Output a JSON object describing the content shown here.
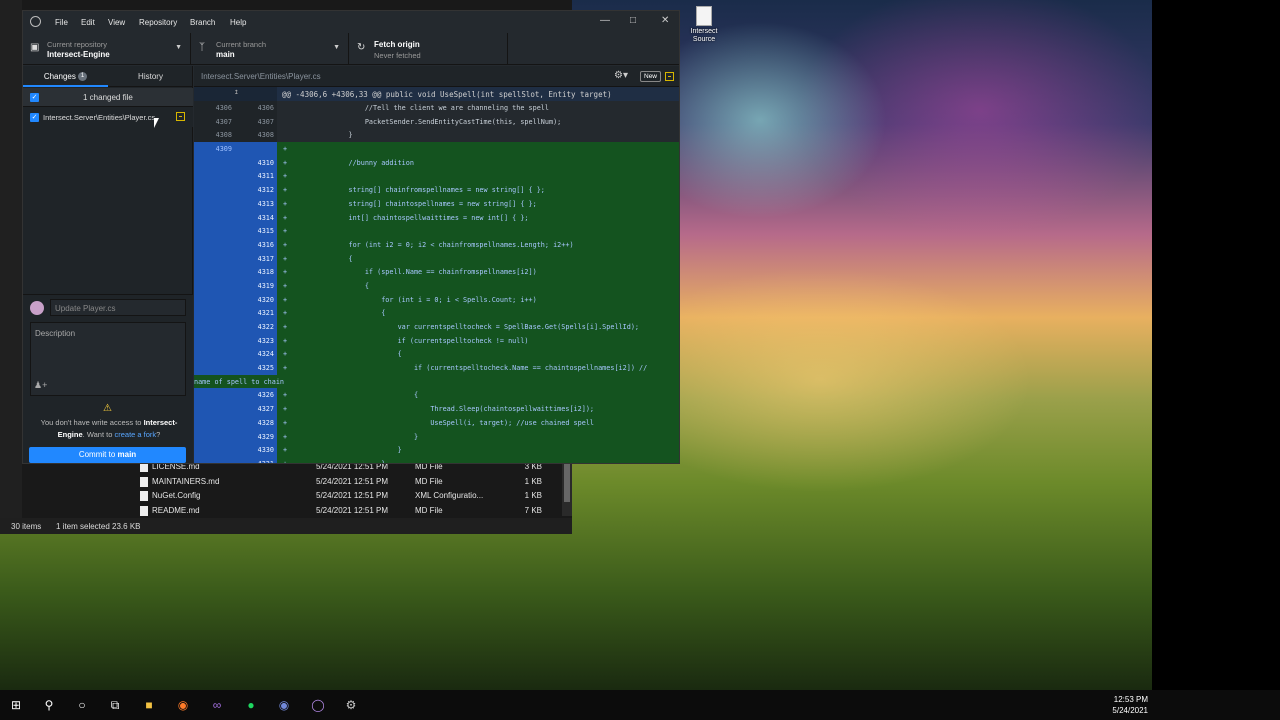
{
  "desktop": {
    "icon_label": "Intersect Source"
  },
  "explorer": {
    "files": [
      {
        "name": "LICENSE.md",
        "date": "5/24/2021 12:51 PM",
        "type": "MD File",
        "size": "3 KB"
      },
      {
        "name": "MAINTAINERS.md",
        "date": "5/24/2021 12:51 PM",
        "type": "MD File",
        "size": "1 KB"
      },
      {
        "name": "NuGet.Config",
        "date": "5/24/2021 12:51 PM",
        "type": "XML Configuratio...",
        "size": "1 KB"
      },
      {
        "name": "README.md",
        "date": "5/24/2021 12:51 PM",
        "type": "MD File",
        "size": "7 KB"
      }
    ],
    "status_items": "30 items",
    "status_selected": "1 item selected  23.6 KB"
  },
  "github": {
    "menu": [
      "File",
      "Edit",
      "View",
      "Repository",
      "Branch",
      "Help"
    ],
    "repo_label": "Current repository",
    "repo_name": "Intersect-Engine",
    "branch_label": "Current branch",
    "branch_name": "main",
    "fetch_label": "Fetch origin",
    "fetch_sub": "Never fetched",
    "tab_changes": "Changes",
    "changes_count": "1",
    "tab_history": "History",
    "changed_files": "1 changed file",
    "file_path": "Intersect.Server\\Entities\\Player.cs",
    "summary_placeholder": "Update Player.cs",
    "description_placeholder": "Description",
    "warn_text_1": "You don't have write access to ",
    "warn_repo": "Intersect-Engine",
    "warn_text_2": ". Want to ",
    "warn_link": "create a fork",
    "warn_text_3": "?",
    "commit_label": "Commit to ",
    "commit_branch": "main",
    "diff_path": "Intersect.Server\\Entities\\Player.cs",
    "new_label": "New",
    "hunk_header": "@@ -4306,6 +4306,33 @@ public void UseSpell(int spellSlot, Entity target)",
    "lines": [
      {
        "kind": "ctx",
        "old": "4306",
        "new": "4306",
        "code": "                    //Tell the client we are channeling the spell"
      },
      {
        "kind": "ctx",
        "old": "4307",
        "new": "4307",
        "code": "                    PacketSender.SendEntityCastTime(this, spellNum);"
      },
      {
        "kind": "ctx",
        "old": "4308",
        "new": "4308",
        "code": "                }"
      },
      {
        "kind": "add",
        "old": "4309",
        "new": "",
        "code": "+"
      },
      {
        "kind": "add",
        "old": "",
        "new": "4310",
        "code": "+               //bunny addition"
      },
      {
        "kind": "add",
        "old": "",
        "new": "4311",
        "code": "+"
      },
      {
        "kind": "add",
        "old": "",
        "new": "4312",
        "code": "+               string[] chainfromspellnames = new string[] { };"
      },
      {
        "kind": "add",
        "old": "",
        "new": "4313",
        "code": "+               string[] chaintospellnames = new string[] { };"
      },
      {
        "kind": "add",
        "old": "",
        "new": "4314",
        "code": "+               int[] chaintospellwaittimes = new int[] { };"
      },
      {
        "kind": "add",
        "old": "",
        "new": "4315",
        "code": "+"
      },
      {
        "kind": "add",
        "old": "",
        "new": "4316",
        "code": "+               for (int i2 = 0; i2 < chainfromspellnames.Length; i2++)"
      },
      {
        "kind": "add",
        "old": "",
        "new": "4317",
        "code": "+               {"
      },
      {
        "kind": "add",
        "old": "",
        "new": "4318",
        "code": "+                   if (spell.Name == chainfromspellnames[i2])"
      },
      {
        "kind": "add",
        "old": "",
        "new": "4319",
        "code": "+                   {"
      },
      {
        "kind": "add",
        "old": "",
        "new": "4320",
        "code": "+                       for (int i = 0; i < Spells.Count; i++)"
      },
      {
        "kind": "add",
        "old": "",
        "new": "4321",
        "code": "+                       {"
      },
      {
        "kind": "add",
        "old": "",
        "new": "4322",
        "code": "+                           var currentspelltocheck = SpellBase.Get(Spells[i].SpellId);"
      },
      {
        "kind": "add",
        "old": "",
        "new": "4323",
        "code": "+                           if (currentspelltocheck != null)"
      },
      {
        "kind": "add",
        "old": "",
        "new": "4324",
        "code": "+                           {"
      },
      {
        "kind": "add",
        "old": "",
        "new": "4325",
        "code": "+                               if (currentspelltocheck.Name == chaintospellnames[i2]) //"
      },
      {
        "kind": "add wrap",
        "old": "",
        "new": "",
        "code": "name of spell to chain"
      },
      {
        "kind": "add",
        "old": "",
        "new": "4326",
        "code": "+                               {"
      },
      {
        "kind": "add",
        "old": "",
        "new": "4327",
        "code": "+                                   Thread.Sleep(chaintospellwaittimes[i2]);"
      },
      {
        "kind": "add",
        "old": "",
        "new": "4328",
        "code": "+                                   UseSpell(i, target); //use chained spell"
      },
      {
        "kind": "add",
        "old": "",
        "new": "4329",
        "code": "+                               }"
      },
      {
        "kind": "add",
        "old": "",
        "new": "4330",
        "code": "+                           }"
      },
      {
        "kind": "add",
        "old": "",
        "new": "4331",
        "code": "+                       }"
      }
    ]
  },
  "taskbar": {
    "time": "12:53 PM",
    "date": "5/24/2021"
  }
}
